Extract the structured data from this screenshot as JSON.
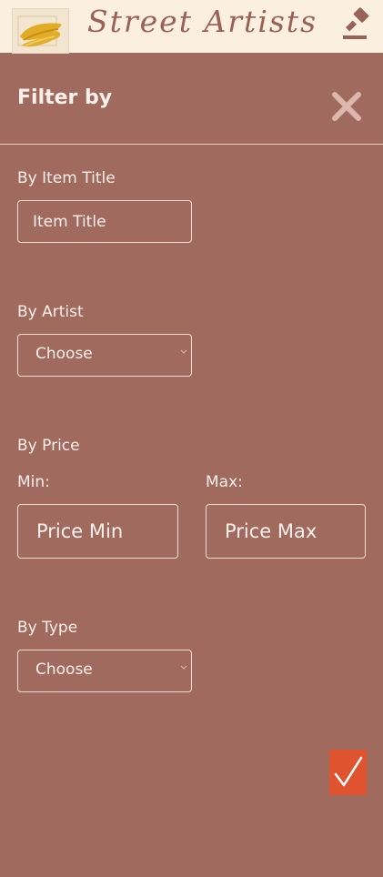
{
  "header": {
    "brand": "Street Artists",
    "logo_icon": "paint-brush-stroke-logo",
    "auction_icon": "gavel-icon",
    "colors": {
      "background": "#fbefe0",
      "brand_text": "#9a6156",
      "logo_paint": "#e2ad26"
    }
  },
  "filter": {
    "title": "Filter by",
    "close_icon": "close-icon",
    "item_title": {
      "label": "By Item Title",
      "placeholder": "Item Title",
      "value": ""
    },
    "artist": {
      "label": "By Artist",
      "selected": "Choose"
    },
    "price": {
      "label": "By Price",
      "min_label": "Min:",
      "max_label": "Max:",
      "min_placeholder": "Price Min",
      "max_placeholder": "Price Max"
    },
    "type": {
      "label": "By Type",
      "selected": "Choose"
    },
    "submit_icon": "checkmark-icon",
    "colors": {
      "panel_background": "#a06a5f",
      "submit_button": "#e0532f",
      "text": "#fbf1ea"
    }
  }
}
